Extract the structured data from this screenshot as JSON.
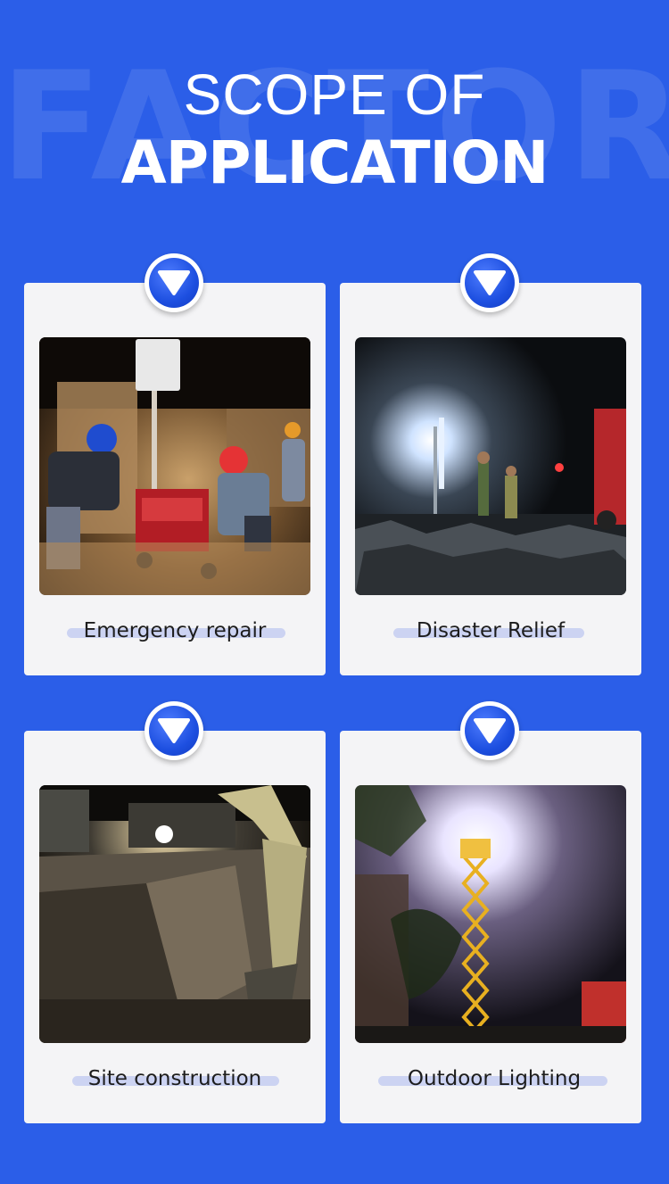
{
  "background_word": "FACTORY",
  "title": {
    "line1": "SCOPE OF",
    "line2": "APPLICATION"
  },
  "colors": {
    "background": "#2b5ee8",
    "card": "#f4f4f6",
    "badge": "#1d4fe0",
    "caption_highlight": "#ccd3f2"
  },
  "cards": [
    {
      "caption": "Emergency repair",
      "photo": "workers repairing a light tower generator at night",
      "icon": "chevron-down-icon"
    },
    {
      "caption": "Disaster Relief",
      "photo": "rescue workers lit by a mast light at night",
      "icon": "chevron-down-icon"
    },
    {
      "caption": "Site construction",
      "photo": "excavator digging under a floodlight at night",
      "icon": "chevron-down-icon"
    },
    {
      "caption": "Outdoor Lighting",
      "photo": "yellow scissor-lift light tower shining at night",
      "icon": "chevron-down-icon"
    }
  ]
}
